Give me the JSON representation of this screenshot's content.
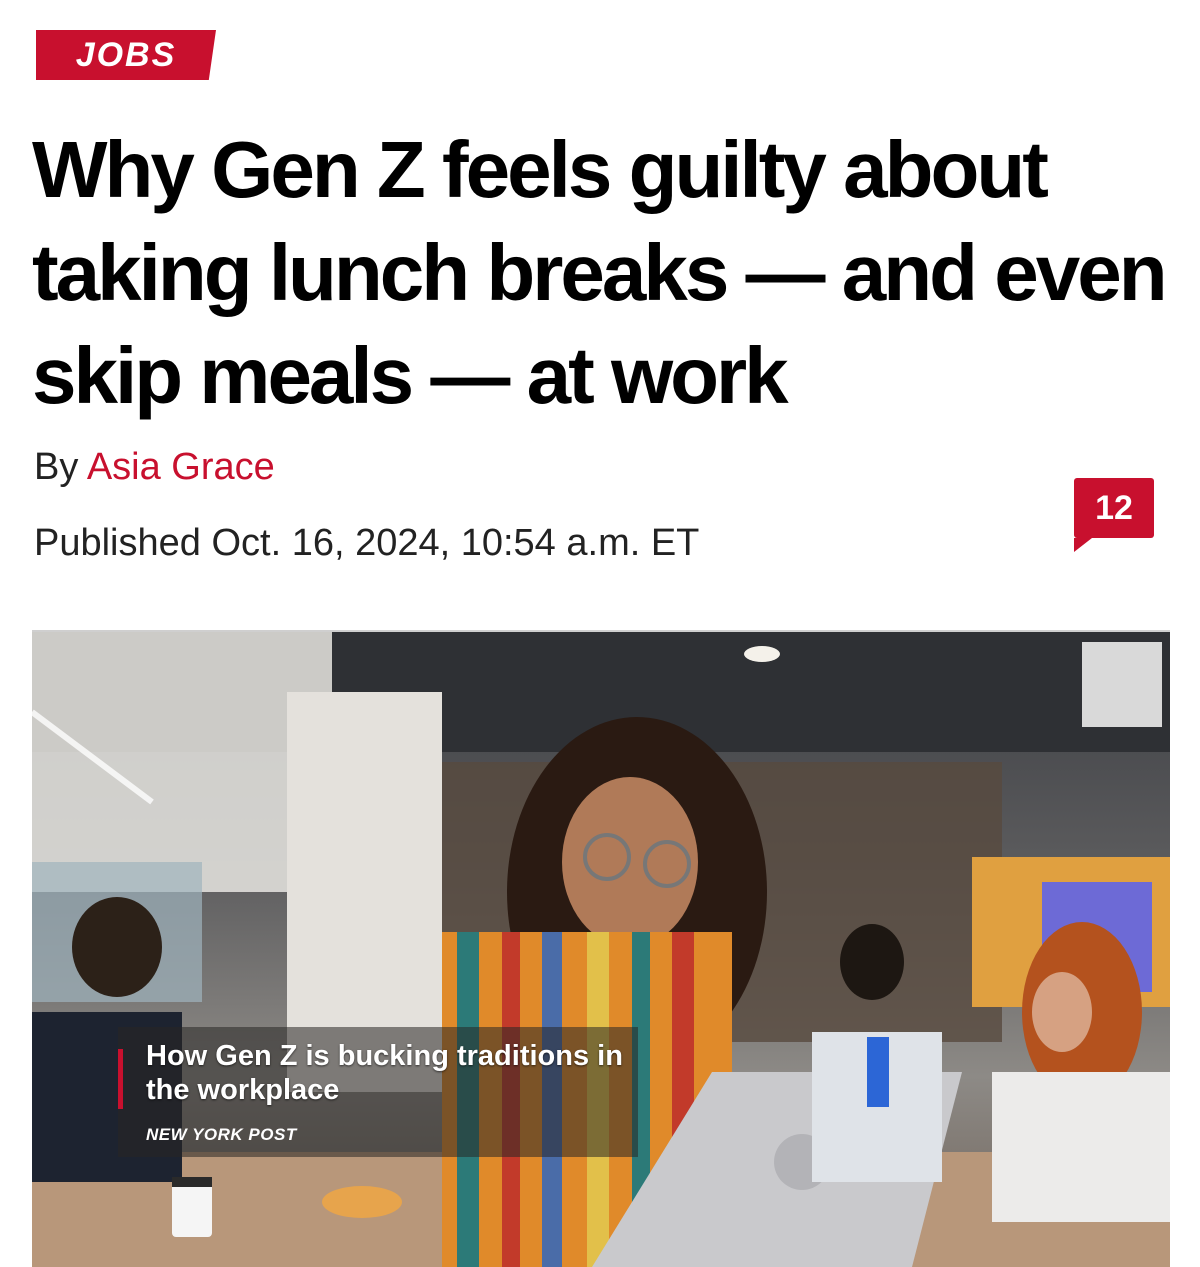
{
  "section": {
    "label": "JOBS"
  },
  "article": {
    "headline": "Why Gen Z feels guilty about taking lunch breaks — and even skip meals — at work",
    "byline_prefix": "By",
    "author": "Asia Grace",
    "published": "Published Oct. 16, 2024, 10:54 a.m. ET",
    "comment_count": "12"
  },
  "video": {
    "caption": "How Gen Z is bucking traditions in the workplace",
    "brand": "NEW YORK POST"
  },
  "colors": {
    "accent": "#c8102e"
  }
}
